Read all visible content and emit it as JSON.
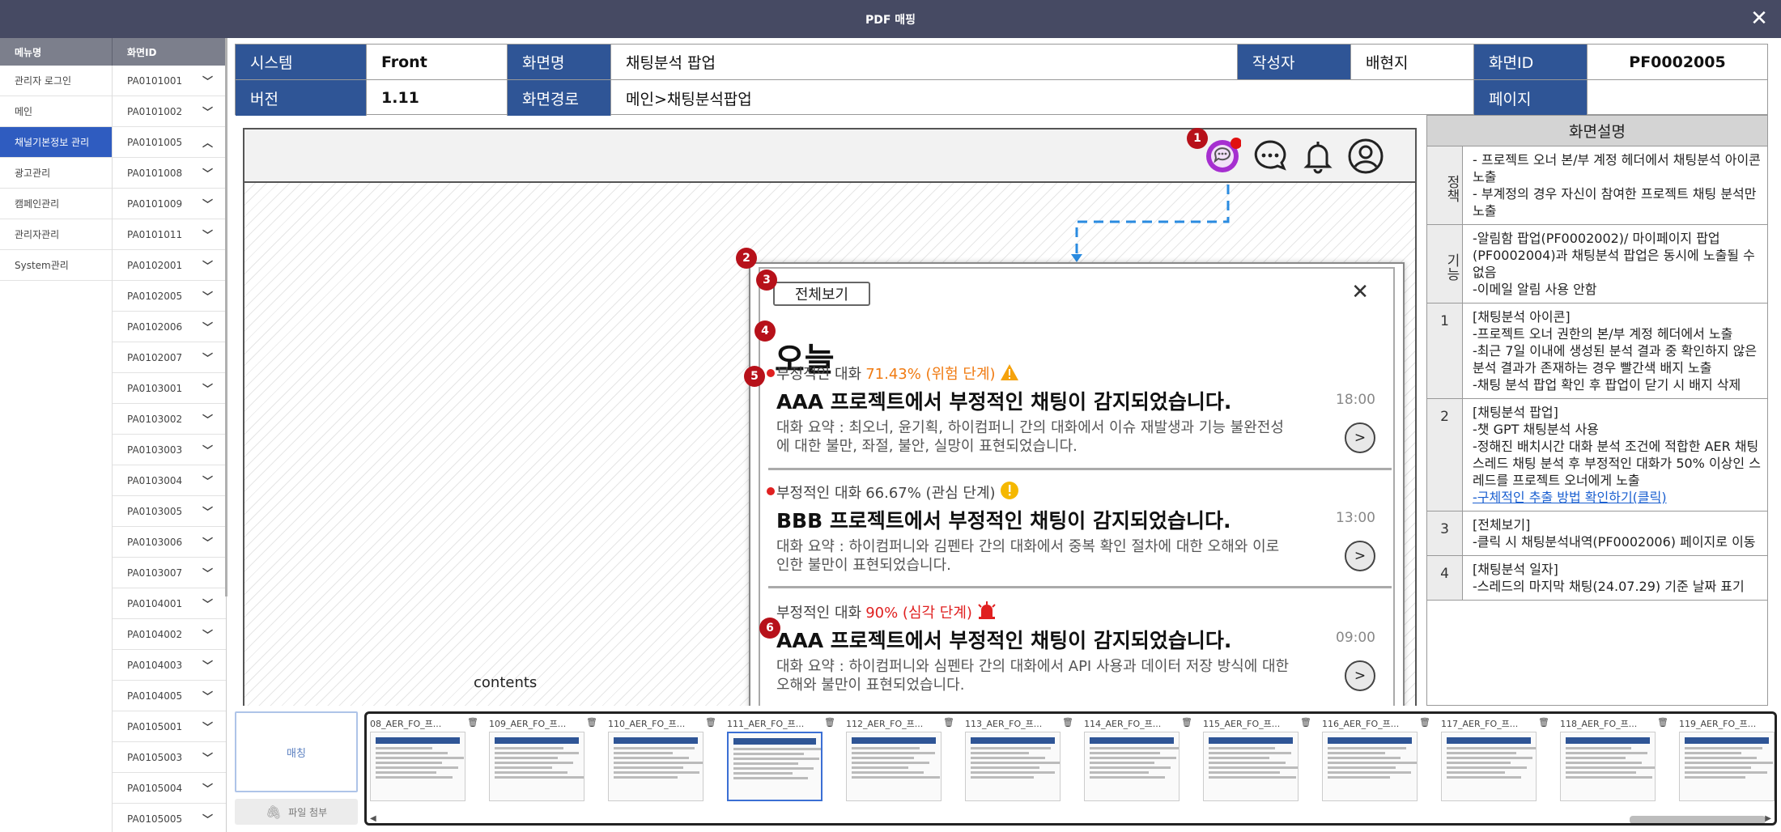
{
  "window": {
    "title": "PDF 매핑",
    "close": "✕"
  },
  "sidebar": {
    "col1_header": "메뉴명",
    "col2_header": "화면ID",
    "menus": [
      "관리자 로그인",
      "메인",
      "채널기본정보 관리",
      "광고관리",
      "캠페인관리",
      "관리자관리",
      "System관리"
    ],
    "active_menu_index": 2,
    "ids": [
      "PA0101001",
      "PA0101002",
      "PA0101005",
      "PA0101008",
      "PA0101009",
      "PA0101011",
      "PA0102001",
      "PA0102005",
      "PA0102006",
      "PA0102007",
      "PA0103001",
      "PA0103002",
      "PA0103003",
      "PA0103004",
      "PA0103005",
      "PA0103006",
      "PA0103007",
      "PA0104001",
      "PA0104002",
      "PA0104003",
      "PA0104005",
      "PA0105001",
      "PA0105003",
      "PA0105004",
      "PA0105005"
    ],
    "expanded_id_index": 2
  },
  "meta": {
    "system_label": "시스템",
    "system_value": "Front",
    "screen_name_label": "화면명",
    "screen_name_value": "채팅분석 팝업",
    "author_label": "작성자",
    "author_value": "배현지",
    "screen_id_label": "화면ID",
    "screen_id_value": "PF0002005",
    "version_label": "버전",
    "version_value": "1.11",
    "path_label": "화면경로",
    "path_value": "메인>채팅분석팝업",
    "page_label": "페이지",
    "page_value": ""
  },
  "mockup": {
    "contents_label": "contents",
    "badges": [
      "1",
      "2",
      "3",
      "4",
      "5",
      "6"
    ],
    "popup": {
      "view_all": "전체보기",
      "close": "✕",
      "today": "오늘",
      "items": [
        {
          "neg": "부정적인 대화",
          "pct": "71.43% (위험 단계)",
          "pct_color": "#f07b12",
          "icon": "warning-icon",
          "title": "AAA 프로젝트에서 부정적인 채팅이 감지되었습니다.",
          "summary": "대화 요약 : 최오너, 윤기획, 하이컴퍼니 간의 대화에서 이슈 재발생과 기능 불완전성에 대한 불만, 좌절, 불안, 실망이 표현되었습니다.",
          "time": "18:00",
          "arrow": ">"
        },
        {
          "neg": "부정적인 대화",
          "pct": "66.67% (관심 단계)",
          "pct_color": "#444444",
          "icon": "caution-icon",
          "title": "BBB 프로젝트에서 부정적인 채팅이 감지되었습니다.",
          "summary": "대화 요약 : 하이컴퍼니와 김펜타 간의 대화에서 중복 확인 절차에 대한 오해와 이로 인한 불만이 표현되었습니다.",
          "time": "13:00",
          "arrow": ">"
        },
        {
          "neg": "부정적인 대화",
          "pct": "90% (심각 단계)",
          "pct_color": "#e02020",
          "icon": "siren-icon",
          "title": "AAA 프로젝트에서 부정적인 채팅이 감지되었습니다.",
          "summary": "대화 요약 : 하이컴퍼니와 심펜타 간의 대화에서 API 사용과 데이터 저장 방식에 대한 오해와 불만이 표현되었습니다.",
          "time": "09:00",
          "arrow": ">"
        }
      ]
    }
  },
  "description": {
    "title": "화면설명",
    "rows": [
      {
        "key": "정책",
        "lines": [
          "- 프로젝트 오너 본/부 계정 헤더에서 채팅분석 아이콘 노출",
          "- 부계정의 경우 자신이 참여한 프로젝트 채팅 분석만 노출"
        ]
      },
      {
        "key": "기능",
        "lines": [
          "-알림함 팝업(PF0002002)/ 마이페이지 팝업(PF0002004)과 채팅분석 팝업은 동시에 노출될 수 없음",
          "-이메일 알림 사용 안함"
        ]
      },
      {
        "key": "1",
        "lines": [
          "[채팅분석 아이콘]",
          "-프로젝트 오너 권한의 본/부 계정 헤더에서 노출",
          "-최근 7일 이내에 생성된 분석 결과 중 확인하지 않은 분석 결과가 존재하는 경우 빨간색 배지 노출",
          "-채팅 분석 팝업 확인 후 팝업이 닫기 시 배지 삭제"
        ]
      },
      {
        "key": "2",
        "lines": [
          "[채팅분석 팝업]",
          "-챗 GPT 채팅분석 사용",
          "-정해진 배치시간 대화 분석 조건에 적합한 AER 채팅 스레드 채팅 분석 후 부정적인 대화가 50% 이상인 스레드를 프로젝트 오너에게 노출"
        ],
        "link": "-구체적인 추출 방법 확인하기(클릭)"
      },
      {
        "key": "3",
        "lines": [
          "[전체보기]",
          "-클릭 시 채팅분석내역(PF0002006) 페이지로 이동"
        ]
      },
      {
        "key": "4",
        "lines": [
          "[채팅분석 일자]",
          "-스레드의 마지막 채팅(24.07.29) 기준 날짜 표기"
        ]
      }
    ]
  },
  "bottom": {
    "match_label": "매칭",
    "attach_label": "파일 첨부",
    "thumbnails": [
      "08_AER_FO_프...",
      "109_AER_FO_프...",
      "110_AER_FO_프...",
      "111_AER_FO_프...",
      "112_AER_FO_프...",
      "113_AER_FO_프...",
      "114_AER_FO_프...",
      "115_AER_FO_프...",
      "116_AER_FO_프...",
      "117_AER_FO_프...",
      "118_AER_FO_프...",
      "119_AER_FO_프..."
    ],
    "selected_thumbnail_index": 3
  }
}
